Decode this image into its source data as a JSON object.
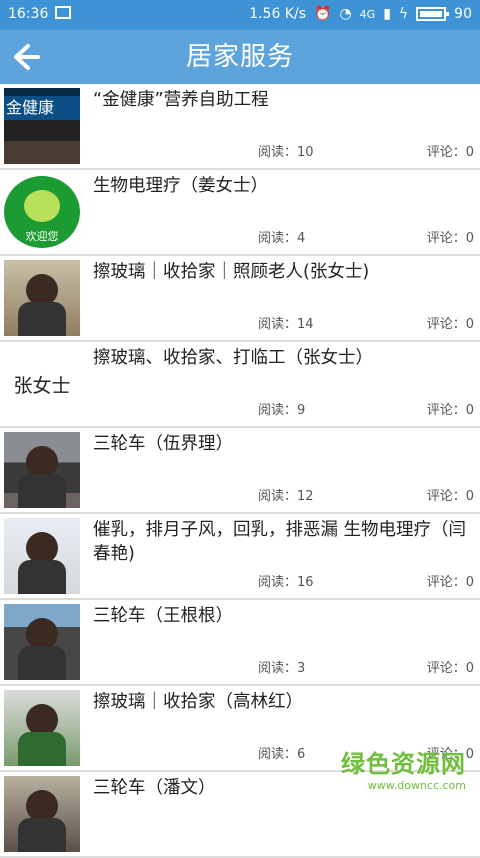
{
  "status": {
    "time": "16:36",
    "speed": "1.56 K/s",
    "battery": "90",
    "network": "4G"
  },
  "header": {
    "title": "居家服务"
  },
  "items": [
    {
      "title": "“金健康”营养自助工程",
      "reads": "阅读：10",
      "comments": "评论：0",
      "thumb_icon": "storefront-photo",
      "thumb_text": "金健康"
    },
    {
      "title": "生物电理疗（姜女士）",
      "reads": "阅读：4",
      "comments": "评论：0",
      "thumb_icon": "circular-logo",
      "thumb_text": "欢迎您"
    },
    {
      "title": "擦玻璃｜收拾家｜照顾老人(张女士)",
      "reads": "阅读：14",
      "comments": "评论：0",
      "thumb_icon": "person-photo"
    },
    {
      "title": "擦玻璃、收拾家、打临工（张女士）",
      "reads": "阅读：9",
      "comments": "评论：0",
      "thumb_text": "张女士"
    },
    {
      "title": "三轮车（伍界理）",
      "reads": "阅读：12",
      "comments": "评论：0",
      "thumb_icon": "person-photo"
    },
    {
      "title": "催乳，排月子风，回乳，排恶漏 生物电理疗（闫春艳)",
      "reads": "阅读：16",
      "comments": "评论：0",
      "thumb_icon": "person-photo"
    },
    {
      "title": "三轮车（王根根）",
      "reads": "阅读：3",
      "comments": "评论：0",
      "thumb_icon": "person-photo"
    },
    {
      "title": "擦玻璃｜收拾家（高林红）",
      "reads": "阅读：6",
      "comments": "评论：0",
      "thumb_icon": "person-photo"
    },
    {
      "title": "三轮车（潘文）",
      "reads": "",
      "comments": "",
      "thumb_icon": "person-photo"
    }
  ],
  "watermark": {
    "name": "绿色资源网",
    "url": "www.downcc.com"
  }
}
